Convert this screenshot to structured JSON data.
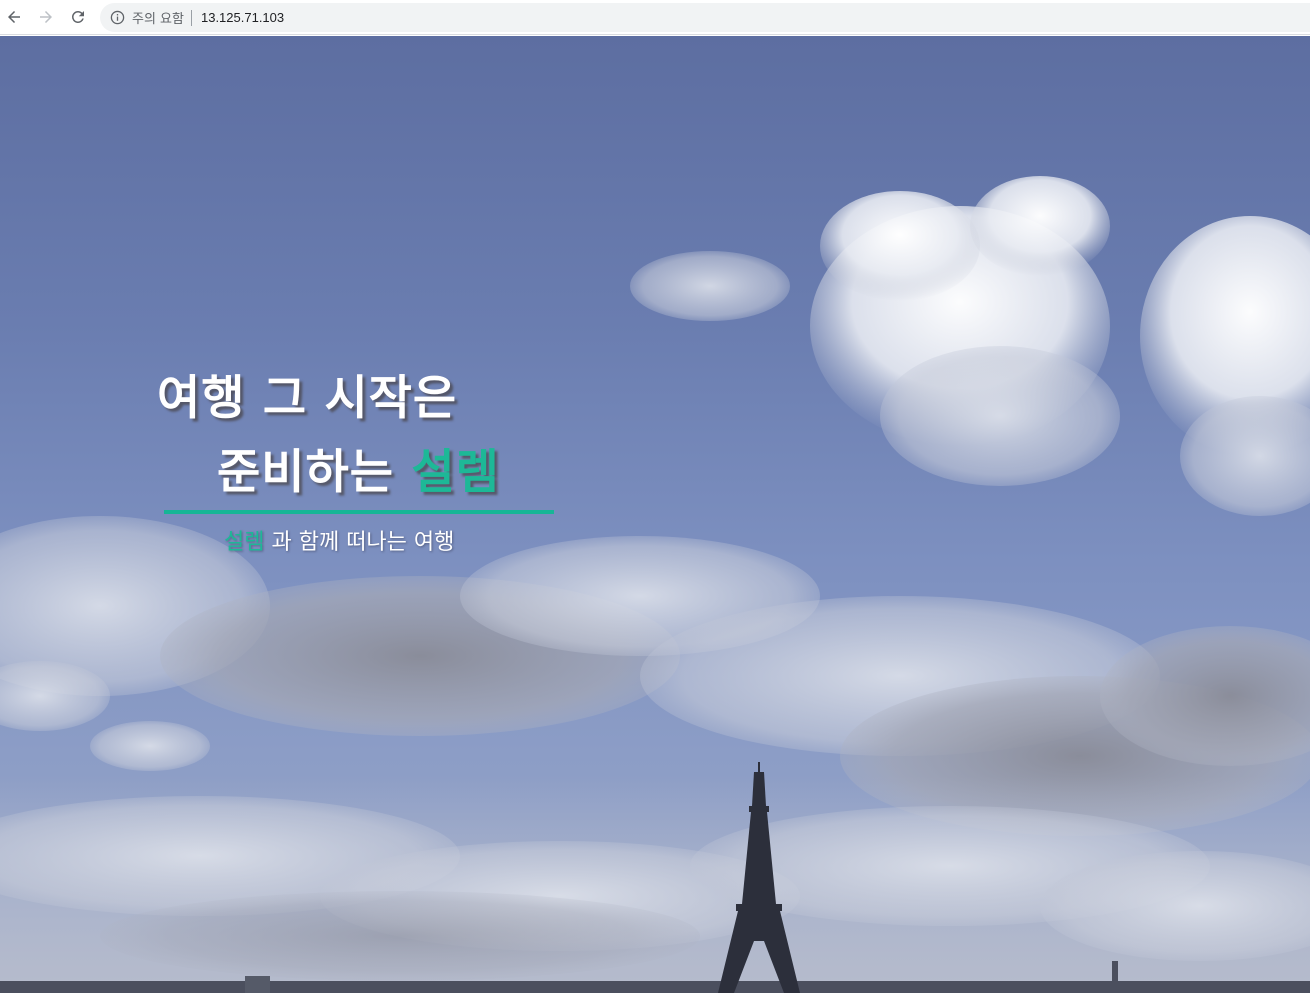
{
  "browser": {
    "security_label": "주의 요함",
    "url": "13.125.71.103"
  },
  "hero": {
    "title_line_1": "여행 그 시작은",
    "title_line_2_prefix": "준비하는",
    "title_line_2_accent": "설렘",
    "subtitle_accent": "설렘",
    "subtitle_rest": "과 함께 떠나는 여행"
  },
  "colors": {
    "accent": "#1db897",
    "sky": "#6a7db0",
    "omnibox": "#f1f3f4"
  },
  "icons": [
    "back-arrow-icon",
    "forward-arrow-icon",
    "reload-icon",
    "info-icon"
  ]
}
